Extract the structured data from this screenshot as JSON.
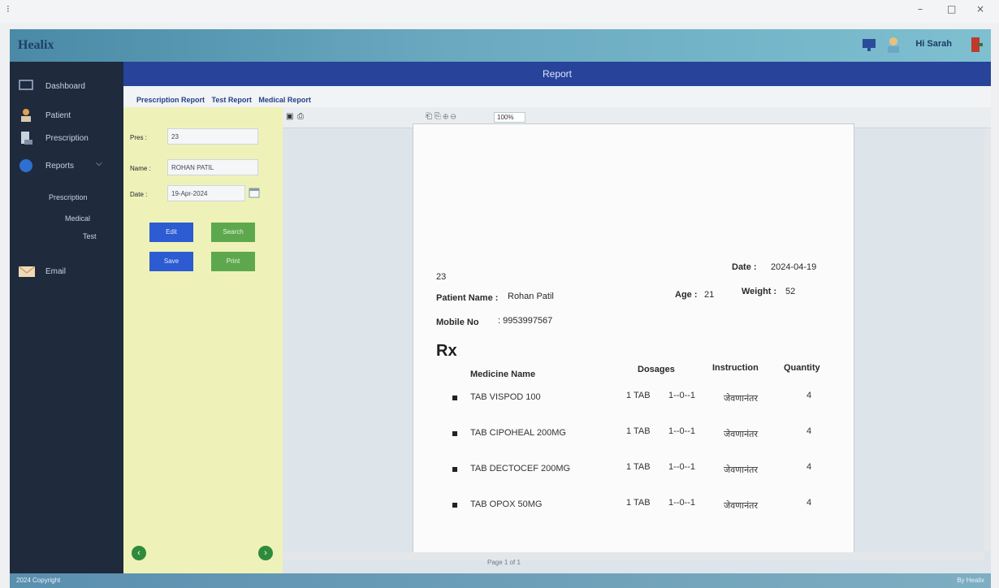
{
  "app": {
    "title": "Healix",
    "user_name": "Hi Sarah",
    "report_header": "Report",
    "copyright": "2024 Copyright",
    "footer_brand": "By Healix"
  },
  "sidebar": {
    "items": [
      {
        "label": "Dashboard",
        "icon": "dashboard-icon"
      },
      {
        "label": "Patient",
        "icon": "user-icon"
      },
      {
        "label": "Prescription",
        "icon": "prescription-icon"
      },
      {
        "label": "Reports",
        "icon": "reports-icon"
      },
      {
        "label": "Email",
        "icon": "email-icon"
      }
    ],
    "subitems": [
      "Prescription",
      "Medical",
      "Test"
    ]
  },
  "tabs": [
    "Prescription Report",
    "Test Report",
    "Medical Report"
  ],
  "form": {
    "pres_label": "Pres :",
    "pres_value": "23",
    "name_label": "Name :",
    "name_value": "ROHAN PATIL",
    "date_label": "Date :",
    "date_value": "19-Apr-2024",
    "buttons": {
      "edit": "Edit",
      "search": "Search",
      "save": "Save",
      "print": "Print"
    }
  },
  "viewer": {
    "page_indicator": "Page 1 of 1",
    "zoom": "100%"
  },
  "report": {
    "id": "23",
    "date_label": "Date :",
    "date_value": "2024-04-19",
    "patient_label": "Patient Name :",
    "patient_value": "Rohan Patil",
    "age_label": "Age :",
    "age_value": "21",
    "weight_label": "Weight :",
    "weight_value": "52",
    "mobile_label": "Mobile No",
    "mobile_value": ": 9953997567",
    "rx": "Rx",
    "headers": {
      "medicine": "Medicine Name",
      "dosage": "Dosages",
      "instruction": "Instruction",
      "quantity": "Quantity"
    },
    "medicines": [
      {
        "name": "TAB VISPOD 100",
        "dose": "1 TAB",
        "schedule": "1--0--1",
        "instruction": "जेवणानंतर",
        "qty": "4"
      },
      {
        "name": "TAB CIPOHEAL 200MG",
        "dose": "1 TAB",
        "schedule": "1--0--1",
        "instruction": "जेवणानंतर",
        "qty": "4"
      },
      {
        "name": "TAB DECTOCEF 200MG",
        "dose": "1 TAB",
        "schedule": "1--0--1",
        "instruction": "जेवणानंतर",
        "qty": "4"
      },
      {
        "name": "TAB OPOX 50MG",
        "dose": "1 TAB",
        "schedule": "1--0--1",
        "instruction": "जेवणानंतर",
        "qty": "4"
      }
    ]
  },
  "colors": {
    "sidebar": "#1f2a3d",
    "header": "#27439a",
    "form_bg": "#eef2b8",
    "blue_btn": "#2d5bd1",
    "green_btn": "#5da84c"
  }
}
